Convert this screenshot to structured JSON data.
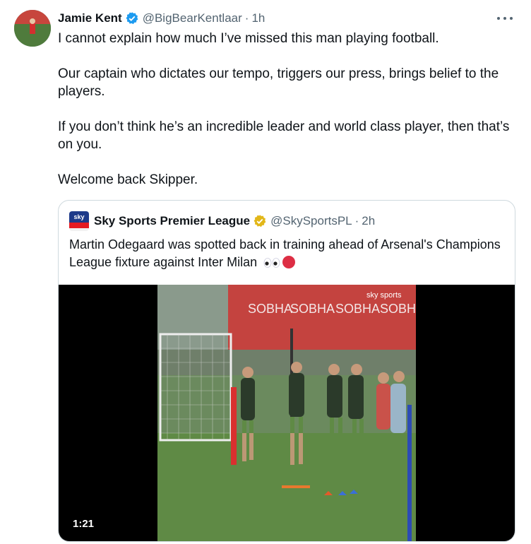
{
  "tweet": {
    "author_name": "Jamie Kent",
    "handle": "@BigBearKentlaar",
    "separator": "·",
    "time": "1h",
    "paragraphs": [
      "I cannot explain how much I’ve missed this man playing football.",
      "Our captain who dictates our tempo, triggers our press, brings belief to the players.",
      "If you don’t think he’s an incredible leader and world class player, then that’s on you.",
      "Welcome back Skipper."
    ]
  },
  "quote": {
    "logo_text": "sky",
    "author_name": "Sky Sports Premier League",
    "handle": "@SkySportsPL",
    "separator": "·",
    "time": "2h",
    "text": "Martin Odegaard was spotted back in training ahead of Arsenal's Champions League fixture against Inter Milan",
    "video": {
      "duration": "1:21",
      "banner_texts": [
        "SOBHA",
        "SOBHA",
        "SOBHA",
        "SOBHA"
      ],
      "watermark": "sky sports"
    }
  },
  "colors": {
    "verified_blue": "#1d9bf0",
    "verified_gold": "#e2b719",
    "secondary_text": "#536471",
    "border": "#cfd9de"
  }
}
